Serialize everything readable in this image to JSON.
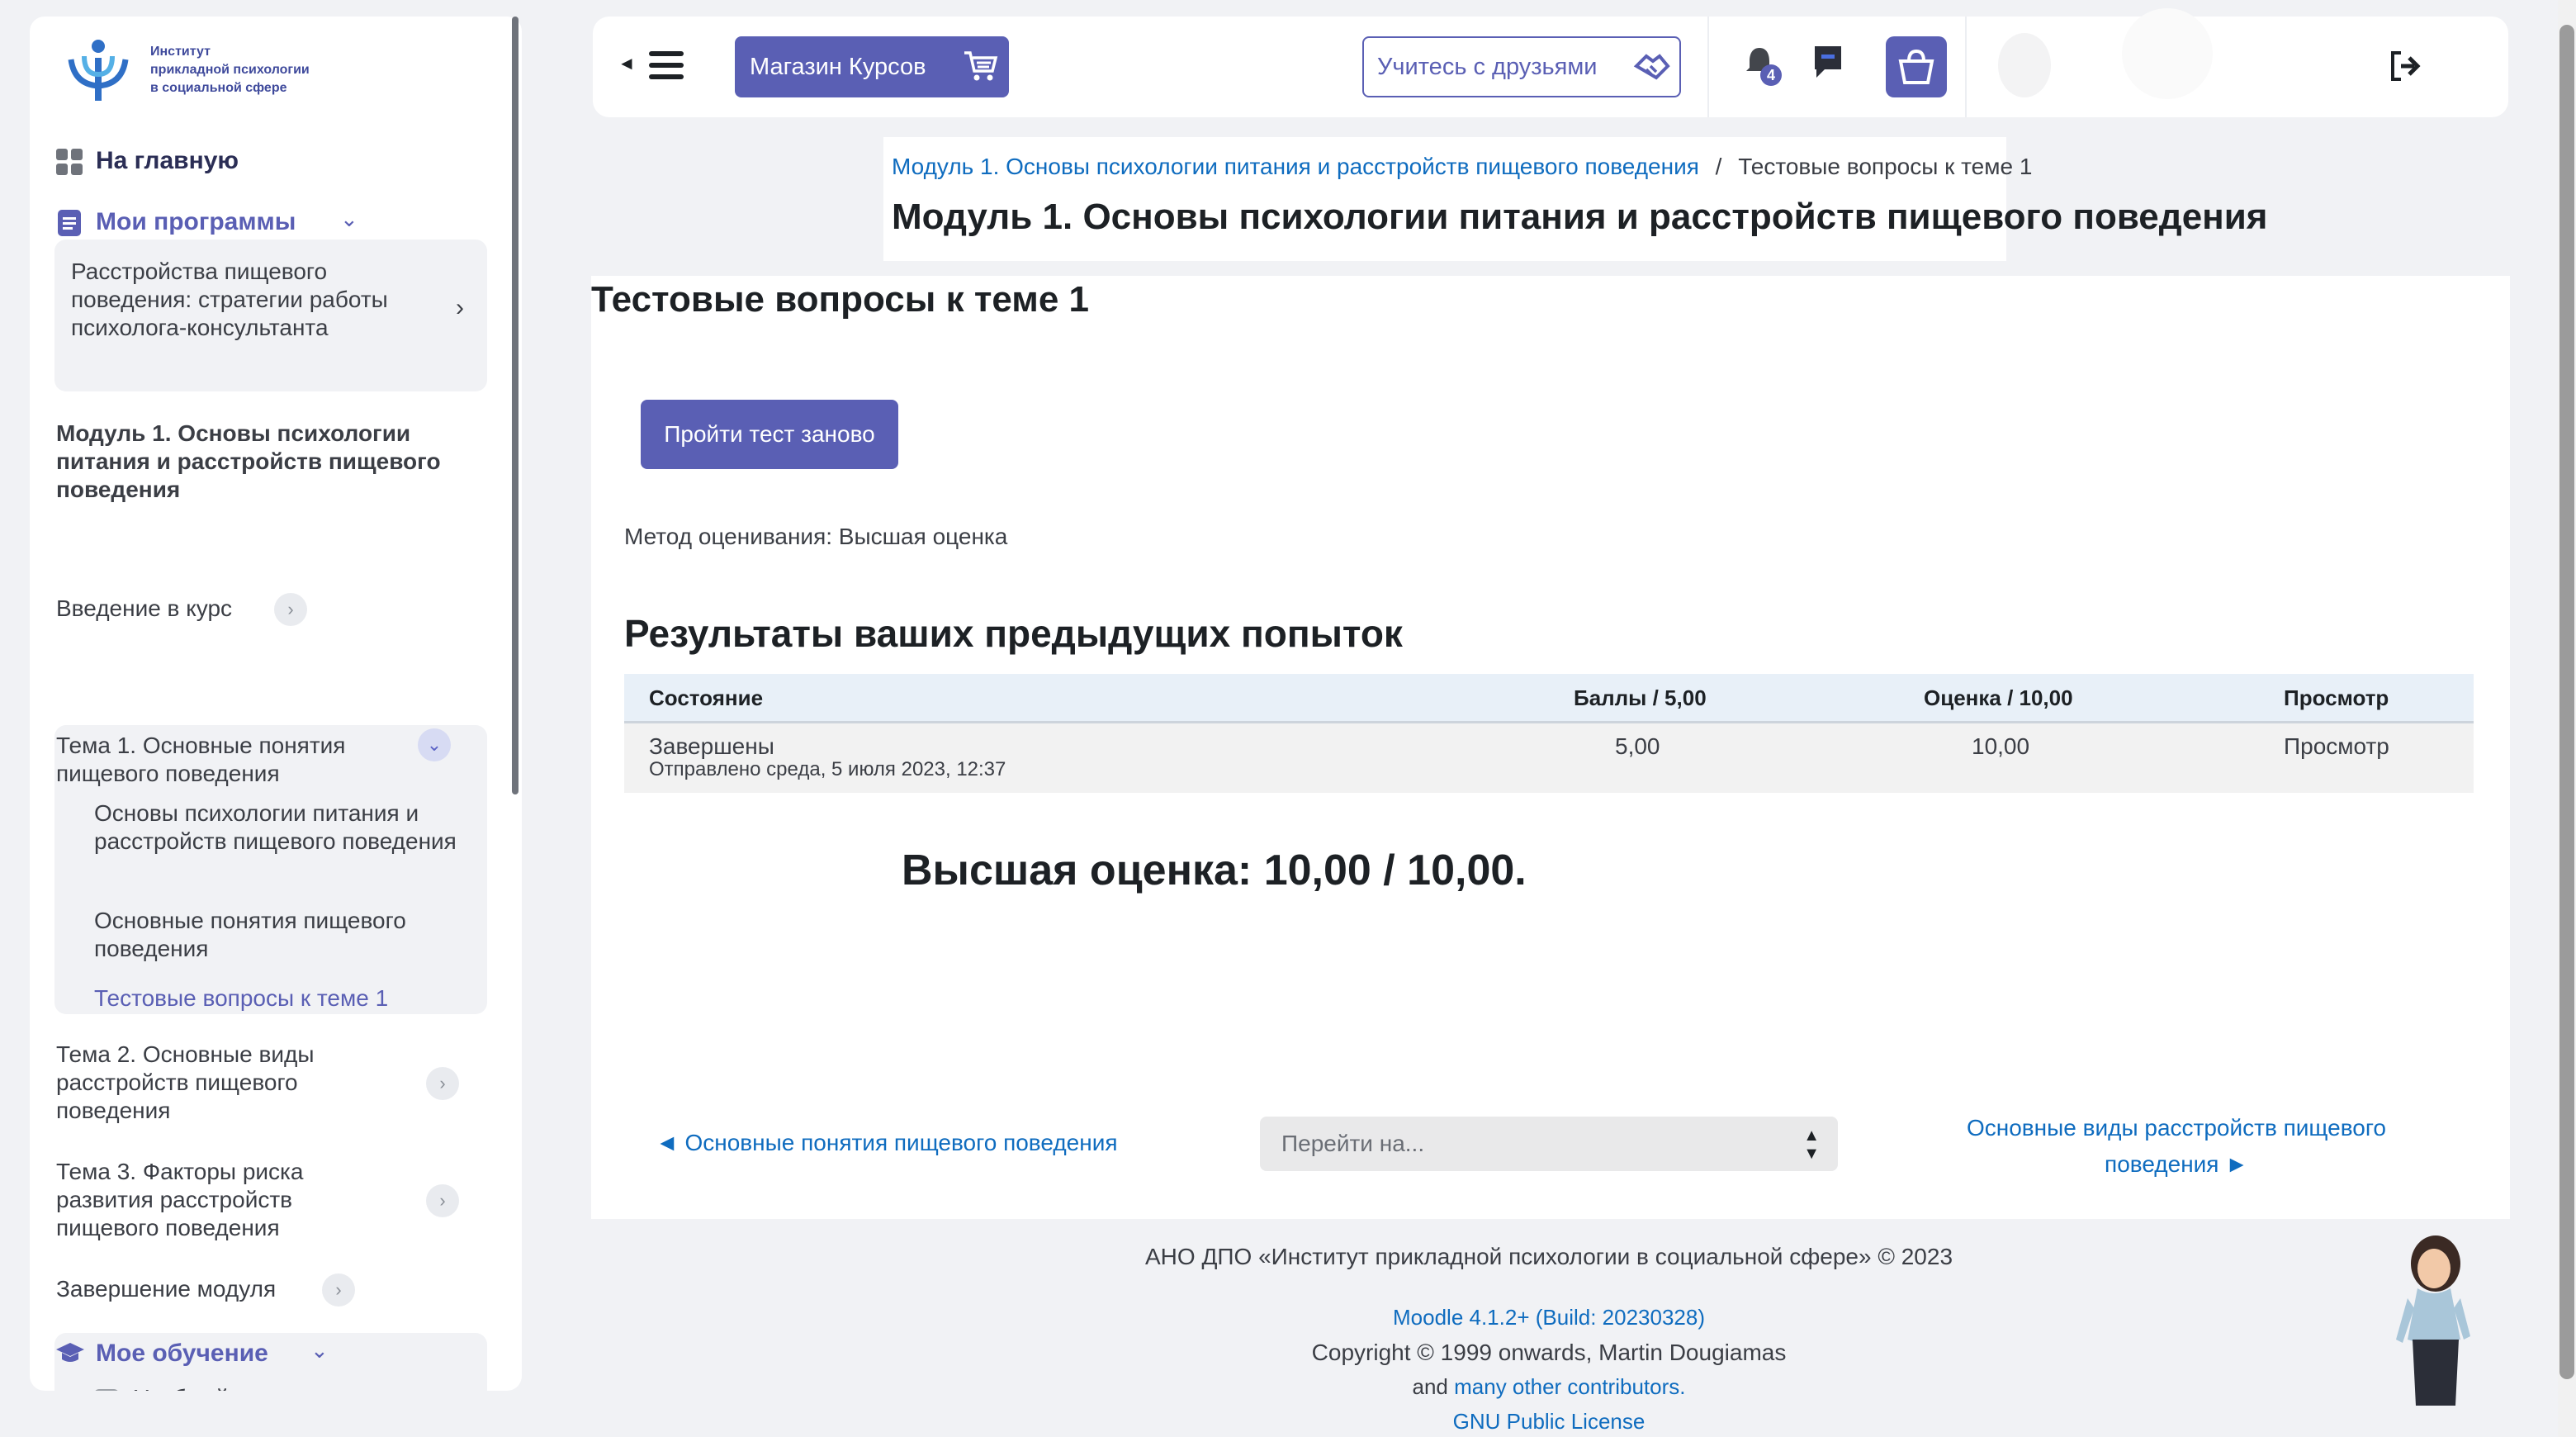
{
  "logo": {
    "line1": "Институт",
    "line2": "прикладной психологии",
    "line3": "в социальной сфере"
  },
  "sidebar": {
    "home": "На главную",
    "my_programs": "Мои программы",
    "program_title": "Расстройства пищевого поведения: стратегии работы психолога-консультанта",
    "module_title": "Модуль 1. Основы психологии питания и расстройств пищевого поведения",
    "intro": "Введение в курс",
    "topic1": "Тема 1. Основные понятия пищевого поведения",
    "topic1_items": [
      "Основы психологии питания и расстройств пищевого поведения",
      "Основные понятия пищевого поведения",
      "Тестовые вопросы к теме 1"
    ],
    "topic2": "Тема 2. Основные виды расстройств пищевого поведения",
    "topic3": "Тема 3. Факторы риска развития расстройств пищевого поведения",
    "completion": "Завершение модуля",
    "my_learning": "Мое обучение",
    "study_plan": "Учебный план"
  },
  "topbar": {
    "shop": "Магазин Курсов",
    "friends": "Учитесь с друзьями",
    "notification_count": "4"
  },
  "breadcrumb": {
    "link": "Модуль 1. Основы психологии питания и расстройств пищевого поведения",
    "separator": "/",
    "current": "Тестовые вопросы к теме 1"
  },
  "page_heading": "Модуль 1. Основы психологии питания и расстройств пищевого поведения",
  "quiz": {
    "title": "Тестовые вопросы к теме 1",
    "retake": "Пройти тест заново",
    "grading_method": "Метод оценивания: Высшая оценка",
    "results_heading": "Результаты ваших предыдущих попыток",
    "columns": [
      "Состояние",
      "Баллы / 5,00",
      "Оценка / 10,00",
      "Просмотр"
    ],
    "row": {
      "state": "Завершены",
      "submitted": "Отправлено среда, 5 июля 2023, 12:37",
      "marks": "5,00",
      "grade": "10,00",
      "review": "Просмотр"
    },
    "best": "Высшая оценка: 10,00 / 10,00."
  },
  "navigation": {
    "prev": "◄ Основные понятия пищевого поведения",
    "jump_placeholder": "Перейти на...",
    "next": "Основные виды расстройств пищевого поведения ►"
  },
  "footer": {
    "org": "АНО ДПО «Институт прикладной психологии в социальной сфере» © 2023",
    "moodle": "Moodle 4.1.2+ (Build: 20230328)",
    "copyright": "Copyright © 1999 onwards, Martin Dougiamas",
    "and": "and",
    "contributors": "many other contributors.",
    "license": "GNU Public License"
  },
  "colors": {
    "accent": "#5a5fb4",
    "link": "#0f6cbf"
  }
}
